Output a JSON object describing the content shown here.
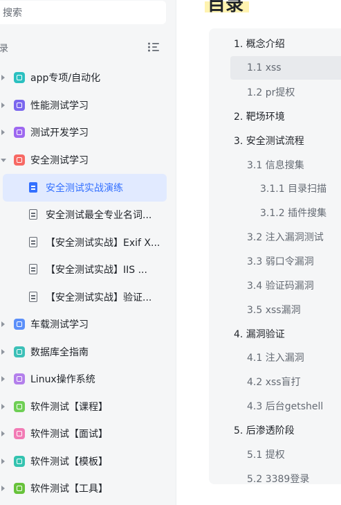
{
  "sidebar": {
    "search_placeholder": "搜索",
    "toc_label": "录",
    "items": [
      {
        "label": "app专项/自动化",
        "icon": "sheet-icon",
        "color": "#2bc0c0"
      },
      {
        "label": "性能测试学习",
        "icon": "cube-icon",
        "color": "#7b67ee"
      },
      {
        "label": "测试开发学习",
        "icon": "window-icon",
        "color": "#9d68f0"
      },
      {
        "label": "安全测试学习",
        "icon": "barcode-icon",
        "color": "#f76964"
      },
      {
        "label": "安全测试实战演练",
        "icon": "doc-icon"
      },
      {
        "label": "安全测试最全专业名词...",
        "icon": "doc-icon"
      },
      {
        "label": "【安全测试实战】Exif X...",
        "icon": "doc-icon"
      },
      {
        "label": "【安全测试实战】IIS ...",
        "icon": "doc-icon"
      },
      {
        "label": "【安全测试实战】验证...",
        "icon": "doc-icon"
      },
      {
        "label": "车载测试学习",
        "icon": "bar-chart-icon",
        "color": "#5b8ff9"
      },
      {
        "label": "数据库全指南",
        "icon": "image-icon",
        "color": "#3cc0b8"
      },
      {
        "label": "Linux操作系统",
        "icon": "bulb-icon",
        "color": "#b37feb"
      },
      {
        "label": "软件测试【课程】",
        "icon": "target-icon",
        "color": "#6fcf55"
      },
      {
        "label": "软件测试【面试】",
        "icon": "chart-icon",
        "color": "#f27bb5"
      },
      {
        "label": "软件测试【模板】",
        "icon": "check-icon",
        "color": "#34c3b0"
      },
      {
        "label": "软件测试【工具】",
        "icon": "grid-icon",
        "color": "#67c23a"
      }
    ]
  },
  "page": {
    "heading": "目录"
  },
  "outline": [
    "1. 概念介绍",
    "1.1 xss",
    "1.2 pr提权",
    "2. 靶场环境",
    "3. 安全测试流程",
    "3.1 信息搜集",
    "3.1.1 目录扫描",
    "3.1.2 插件搜集",
    "3.2 注入漏洞测试",
    "3.3 弱口令漏洞",
    "3.4 验证码漏洞",
    "3.5 xss漏洞",
    "4. 漏洞验证",
    "4.1 注入漏洞",
    "4.2 xss盲打",
    "4.3 后台getshell",
    "5. 后渗透阶段",
    "5.1 提权",
    "5.2 3389登录"
  ]
}
